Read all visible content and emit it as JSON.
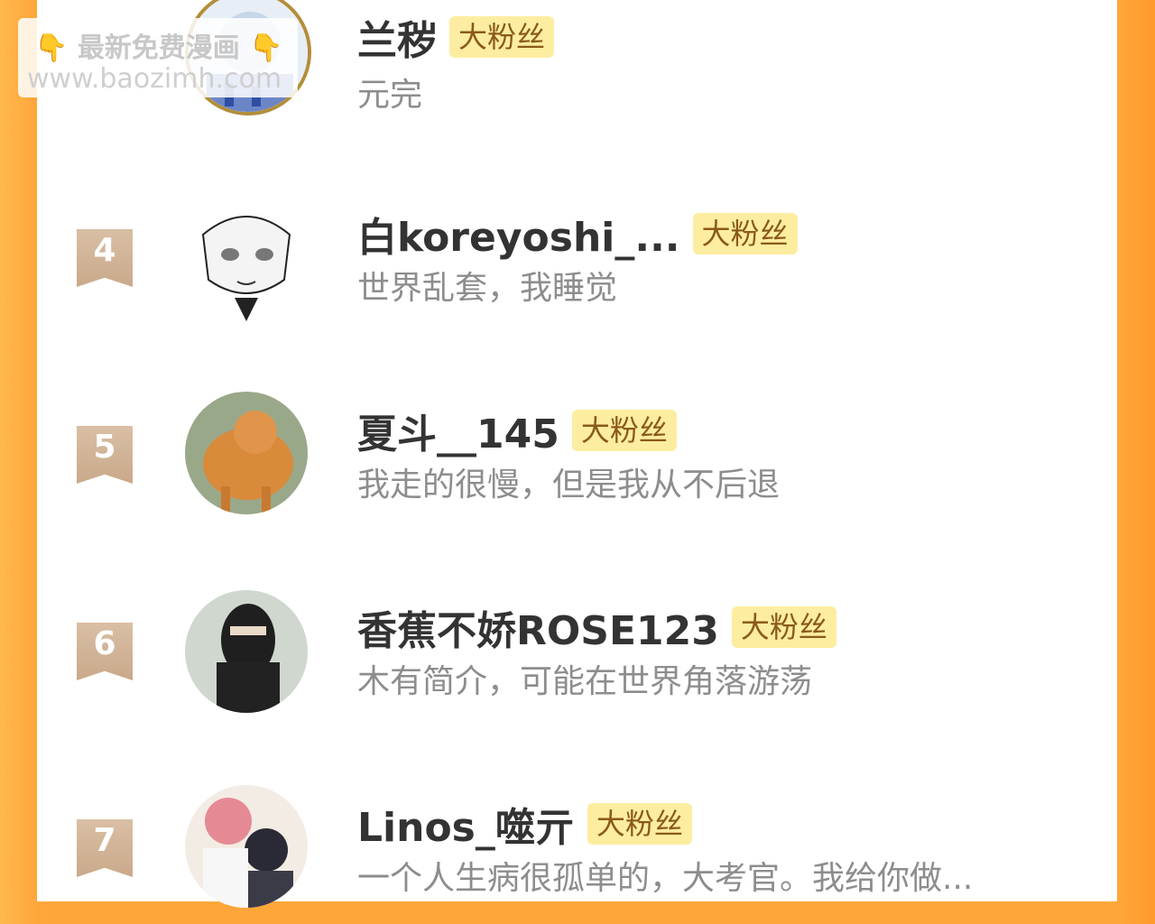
{
  "badge_label": "大粉丝",
  "watermark": {
    "line1": "最新免费漫画",
    "line2": "www.baozimh.com",
    "hand_icon": "👇"
  },
  "users": [
    {
      "rank": "",
      "name": "兰秽",
      "bio": "元完",
      "avatar_icon": "avatar-icon"
    },
    {
      "rank": "4",
      "name": "白koreyoshi_...",
      "bio": "世界乱套，我睡觉",
      "avatar_icon": "avatar-icon"
    },
    {
      "rank": "5",
      "name": "夏斗__145",
      "bio": "我走的很慢，但是我从不后退",
      "avatar_icon": "avatar-icon"
    },
    {
      "rank": "6",
      "name": "香蕉不娇ROSE123",
      "bio": "木有简介，可能在世界角落游荡",
      "avatar_icon": "avatar-icon"
    },
    {
      "rank": "7",
      "name": "Linos_噬亓",
      "bio": "一个人生病很孤单的，大考官。我给你做...",
      "avatar_icon": "avatar-icon"
    }
  ],
  "colors": {
    "side_accent": "#ffa63a",
    "badge_bg": "#fdeda0",
    "badge_text": "#8a5a1a",
    "rank_tag": "#c9a98a"
  }
}
